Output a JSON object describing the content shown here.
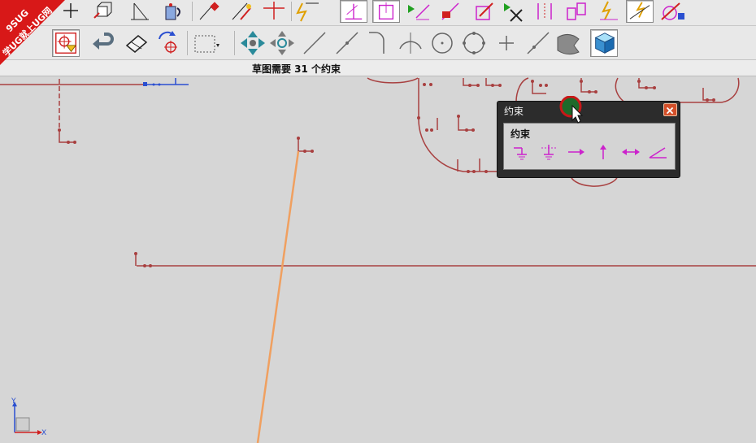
{
  "watermark": {
    "line1": "9SUG",
    "line2": "学UG就上UG网"
  },
  "toolbar_top": {
    "icons": [
      "point-icon",
      "extrude-icon",
      "datum-plane-icon",
      "inventor-tool-icon",
      "sketch-edit-icon",
      "trim-icon",
      "line-cross-icon",
      "quick-dimension-icon",
      "perpendicular-constraint-icon",
      "horizontal-constraint-icon",
      "show-constraints-icon",
      "remove-constraint-icon",
      "animate-dimension-icon",
      "convert-reference-icon",
      "alternate-solution-icon",
      "infer-constraint-icon",
      "auto-dimension-icon",
      "show-all-constraints-icon",
      "update-model-icon"
    ]
  },
  "toolbar_bottom": {
    "icons": [
      "snap-point-filter-icon",
      "undo-arrow-icon",
      "eraser-icon",
      "rotate-point-icon",
      "rectangle-select-icon",
      "move-handles-icon",
      "snap-handles-icon",
      "line-tool-icon",
      "line-midpoint-icon",
      "arc-fillet-icon",
      "arc-intersect-icon",
      "circle-center-icon",
      "circle-quadrant-icon",
      "point-on-curve-icon",
      "tangent-line-icon",
      "face-icon",
      "part-navigator-icon"
    ]
  },
  "status": {
    "text": "草图需要 31 个约束"
  },
  "dialog": {
    "title": "约束",
    "group_label": "约束",
    "constraints": [
      "fixed-constraint-icon",
      "fully-fixed-constraint-icon",
      "horizontal-arrow-constraint-icon",
      "vertical-arrow-constraint-icon",
      "constant-length-constraint-icon",
      "constant-angle-constraint-icon"
    ]
  },
  "wcs": {
    "x_label": "X",
    "y_label": "Y"
  },
  "colors": {
    "sketch_curve": "#a84040",
    "selected_line": "#f0a060",
    "dim_blue": "#2a4fd0",
    "constraint_magenta": "#cc22cc"
  }
}
